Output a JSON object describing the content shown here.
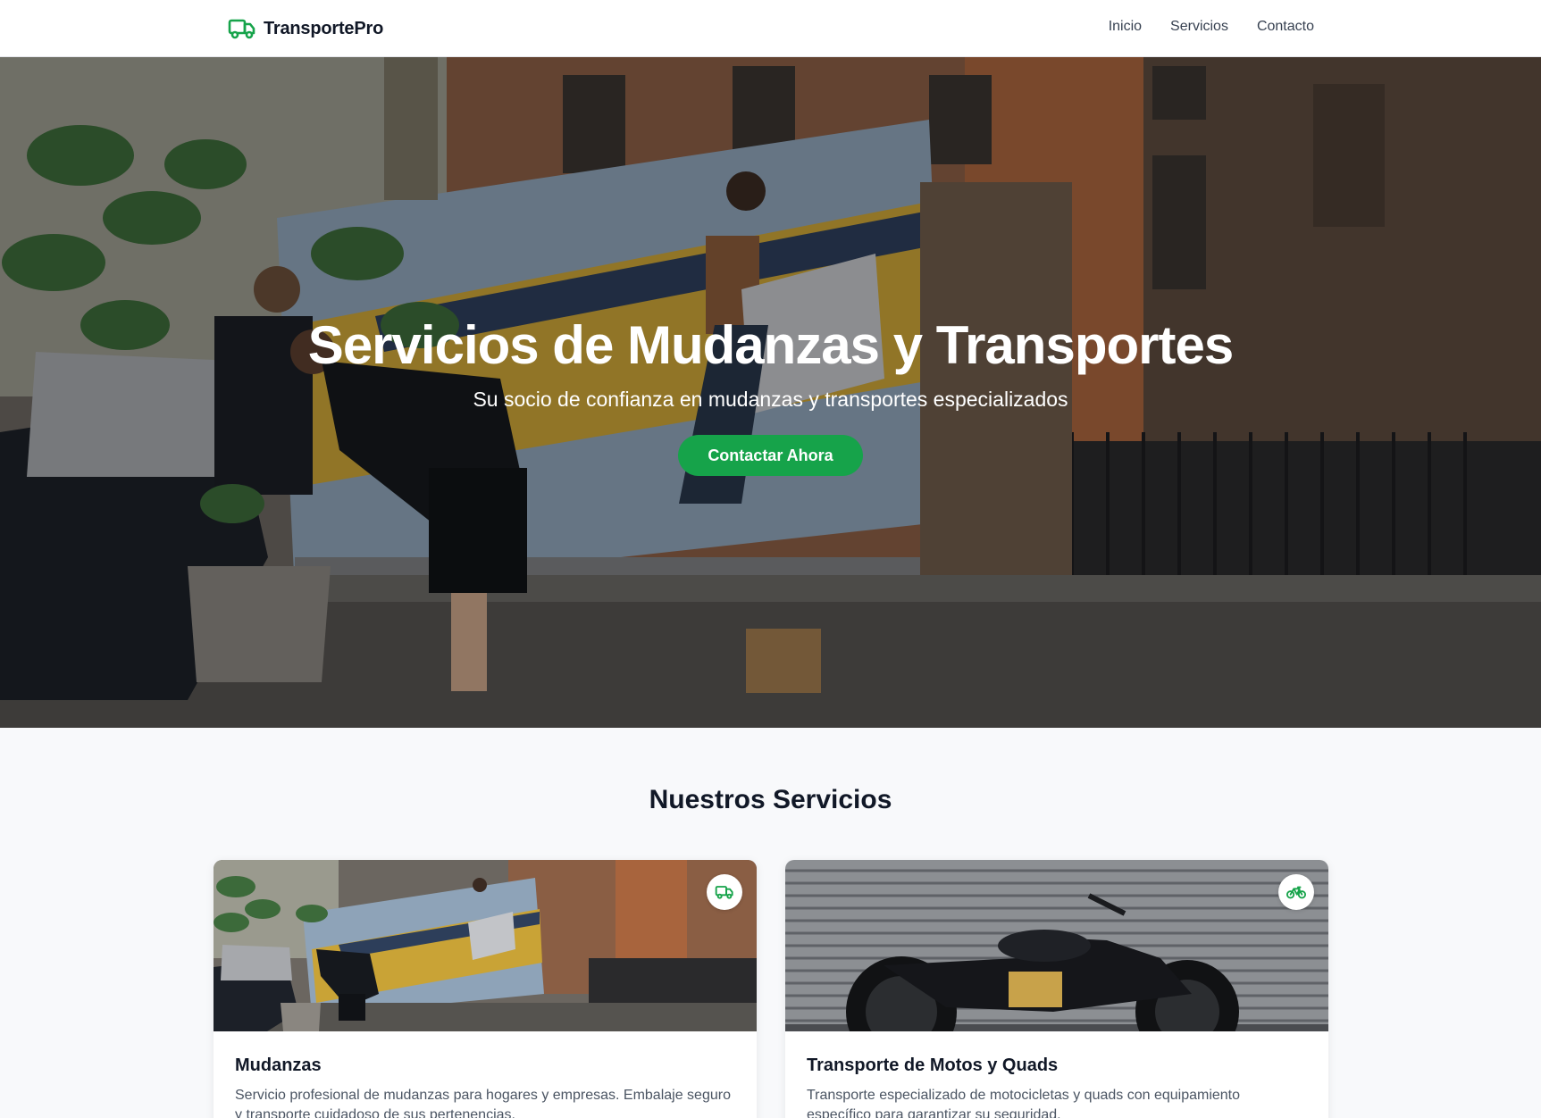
{
  "nav": {
    "brand": "TransportePro",
    "brand_icon": "truck-icon",
    "links": [
      "Inicio",
      "Servicios",
      "Contacto"
    ]
  },
  "hero": {
    "title": "Servicios de Mudanzas y Transportes",
    "subtitle": "Su socio de confianza en mudanzas y transportes especializados",
    "cta": "Contactar Ahora"
  },
  "services": {
    "title": "Nuestros Servicios",
    "cards": [
      {
        "title": "Mudanzas",
        "description": "Servicio profesional de mudanzas para hogares y empresas. Embalaje seguro y transporte cuidadoso de sus pertenencias.",
        "icon": "truck-icon"
      },
      {
        "title": "Transporte de Motos y Quads",
        "description": "Transporte especializado de motocicletas y quads con equipamiento específico para garantizar su seguridad.",
        "icon": "bicycle-icon"
      }
    ]
  },
  "colors": {
    "accent": "#16a34a",
    "text_dark": "#111827",
    "text_muted": "#4b5563",
    "background": "#f8f9fb"
  }
}
